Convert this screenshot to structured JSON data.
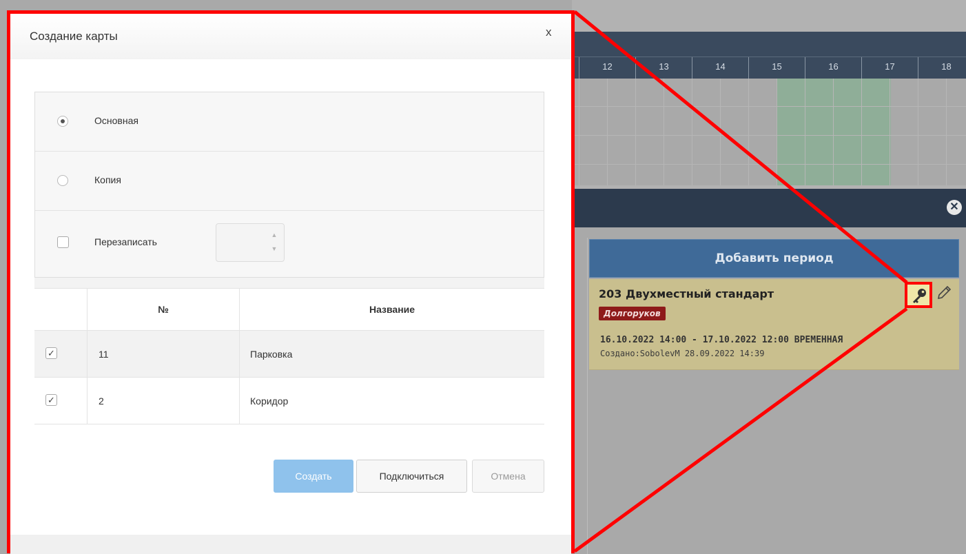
{
  "dialog": {
    "title": "Создание карты",
    "close_label": "x",
    "options": {
      "main_label": "Основная",
      "main_selected": true,
      "copy_label": "Копия",
      "copy_selected": false,
      "overwrite_label": "Перезаписать",
      "overwrite_checked": false,
      "overwrite_value": ""
    },
    "table": {
      "columns": [
        "№",
        "Название"
      ],
      "rows": [
        {
          "checked": true,
          "number": "11",
          "name": "Парковка"
        },
        {
          "checked": true,
          "number": "2",
          "name": "Коридор"
        }
      ]
    },
    "buttons": {
      "create": "Создать",
      "connect": "Подключиться",
      "cancel": "Отмена"
    }
  },
  "background": {
    "days": [
      "12",
      "13",
      "14",
      "15",
      "16",
      "17",
      "18"
    ],
    "add_period_label": "Добавить период",
    "booking": {
      "room": "203 Двухместный стандарт",
      "guest": "Долгоруков",
      "dates": "16.10.2022 14:00 - 17.10.2022 12:00 ВРЕМЕННАЯ",
      "created": "Создано:SobolevM 28.09.2022 14:39"
    }
  },
  "colors": {
    "callout_red": "#ff0000",
    "primary_button": "#8fc2ec",
    "header_dark": "#2c3a4d",
    "booking_card": "#c9bf8e",
    "guest_badge": "#8e1a1a"
  },
  "icons": [
    "close-icon",
    "key-icon",
    "pencil-icon",
    "circle-close-icon",
    "radio-icon",
    "checkbox-icon",
    "spinner-up-icon",
    "spinner-down-icon"
  ]
}
